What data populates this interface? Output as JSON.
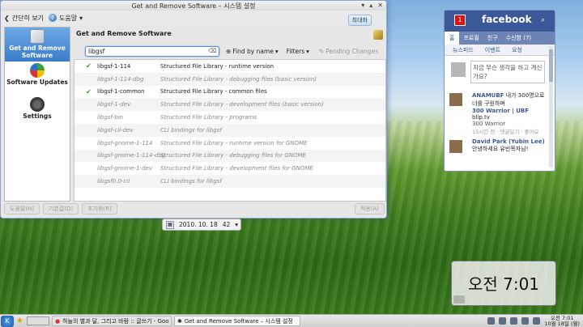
{
  "window": {
    "title": "Get and Remove Software – 시스템 설정",
    "menu_overview": "간단히 보기",
    "menu_help": "도움말",
    "maximize_label": "최대화"
  },
  "sidebar": {
    "items": [
      {
        "label": "Get and Remove Software"
      },
      {
        "label": "Software Updates"
      },
      {
        "label": "Settings"
      }
    ]
  },
  "panel": {
    "title": "Get and Remove Software",
    "search_value": "libgsf",
    "find_by": "Find by name",
    "filters": "Filters",
    "pending": "Pending Changes"
  },
  "packages": [
    {
      "name": "libgsf-1-114",
      "desc": "Structured File Library - runtime version",
      "installed": true
    },
    {
      "name": "libgsf-1-114-dbg",
      "desc": "Structured File Library - debugging files (basic version)",
      "installed": false
    },
    {
      "name": "libgsf-1-common",
      "desc": "Structured File Library - common files",
      "installed": true
    },
    {
      "name": "libgsf-1-dev",
      "desc": "Structured File Library - development files (basic version)",
      "installed": false
    },
    {
      "name": "libgsf-bin",
      "desc": "Structured File Library - programs",
      "installed": false
    },
    {
      "name": "libgsf-cil-dev",
      "desc": "CLI bindings for libgsf",
      "installed": false
    },
    {
      "name": "libgsf-gnome-1-114",
      "desc": "Structured File Library - runtime version for GNOME",
      "installed": false
    },
    {
      "name": "libgsf-gnome-1-114-dbg",
      "desc": "Structured File Library - debugging files for GNOME",
      "installed": false
    },
    {
      "name": "libgsf-gnome-1-dev",
      "desc": "Structured File Library - development files for GNOME",
      "installed": false
    },
    {
      "name": "libgsf0.0-cil",
      "desc": "CLI bindings for libgsf",
      "installed": false
    }
  ],
  "bottom_buttons": {
    "help": "도움말(H)",
    "defaults": "기본값(D)",
    "reset": "초기화(R)",
    "apply": "적용(A)"
  },
  "date_widget": {
    "date": "2010. 10. 18",
    "value": "42"
  },
  "clock_widget": {
    "time": "오전 7:01"
  },
  "facebook": {
    "badge": "1",
    "logo": "facebook",
    "tabs": [
      "홈",
      "프로필",
      "친구",
      "수신함 (7)"
    ],
    "subtabs": [
      "뉴스피드",
      "이벤트",
      "요청"
    ],
    "composer_placeholder": "지금 무슨 생각을 하고 계신가요?",
    "feed": [
      {
        "who": "ANAMUBF",
        "text": "내가 300명으로 너를 구원하며",
        "link": "300 Warrior | UBF",
        "site": "blip.tv",
        "sub": "300 Warrior",
        "meta": "15시간 전 · 댓글달기 · 좋아요"
      },
      {
        "who": "David Park",
        "paren": "(Yubin Lee)",
        "text": "안녕하세요 유빈목자님!"
      }
    ]
  },
  "taskbar": {
    "kde_label": "K",
    "task1": "하늘의 별과 달, 그리고 바람 :: 글쓰기 - Goo",
    "task2": "Get and Remove Software – 시스템 설정",
    "time": "오전 7:01",
    "date": "10월 18일 (월)"
  }
}
